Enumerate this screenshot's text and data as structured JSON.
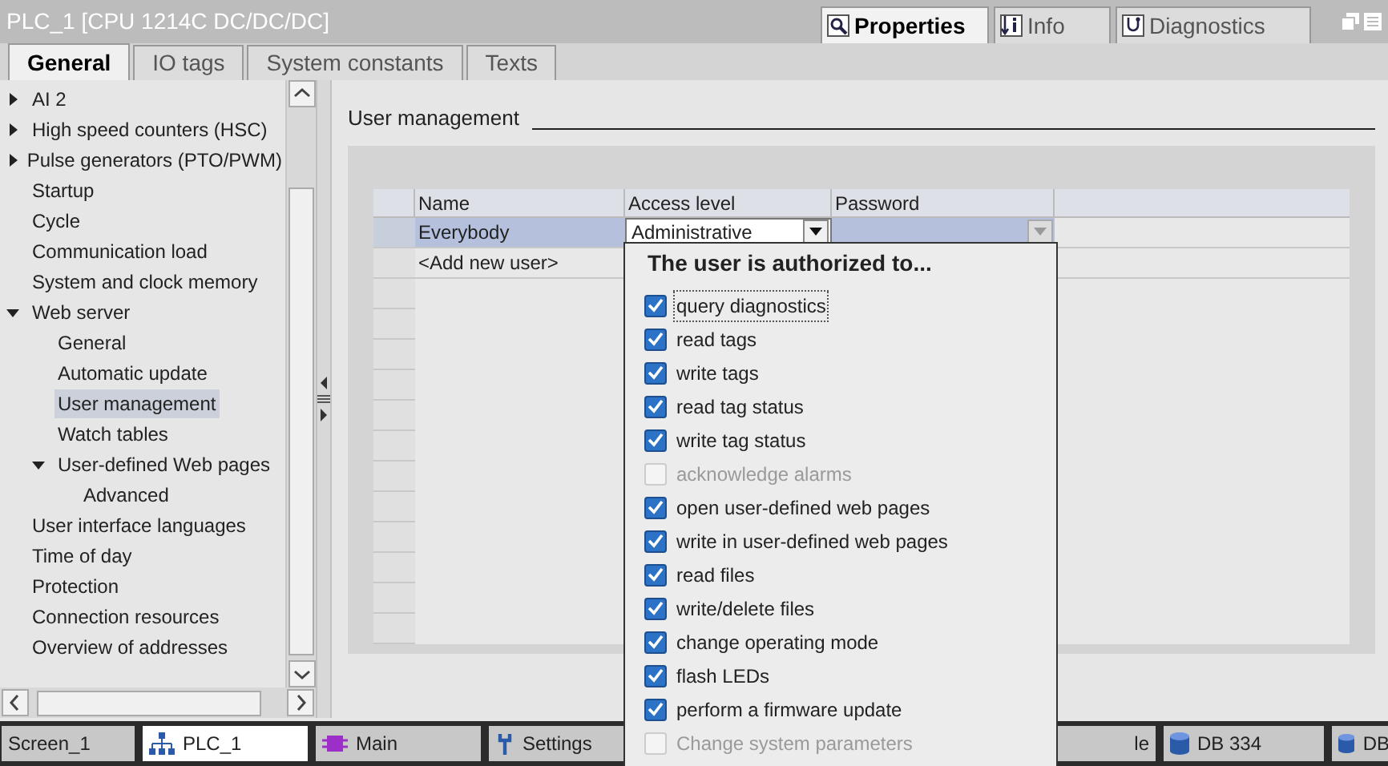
{
  "window": {
    "title": "PLC_1 [CPU 1214C DC/DC/DC]"
  },
  "inspector_tabs": [
    {
      "label": "Properties",
      "selected": true
    },
    {
      "label": "Info",
      "selected": false
    },
    {
      "label": "Diagnostics",
      "selected": false
    }
  ],
  "tabs": [
    {
      "label": "General",
      "selected": true
    },
    {
      "label": "IO tags",
      "selected": false
    },
    {
      "label": "System constants",
      "selected": false
    },
    {
      "label": "Texts",
      "selected": false
    }
  ],
  "sidebar": {
    "items": [
      {
        "label": "AI 2",
        "expanded": false,
        "selected": false
      },
      {
        "label": "High speed counters (HSC)",
        "expanded": false,
        "selected": false
      },
      {
        "label": "Pulse generators (PTO/PWM)",
        "expanded": false,
        "selected": false
      },
      {
        "label": "Startup",
        "selected": false
      },
      {
        "label": "Cycle",
        "selected": false
      },
      {
        "label": "Communication load",
        "selected": false
      },
      {
        "label": "System and clock memory",
        "selected": false
      },
      {
        "label": "Web server",
        "expanded": true,
        "selected": false,
        "children": [
          {
            "label": "General",
            "selected": false
          },
          {
            "label": "Automatic update",
            "selected": false
          },
          {
            "label": "User management",
            "selected": true
          },
          {
            "label": "Watch tables",
            "selected": false
          },
          {
            "label": "User-defined Web pages",
            "expanded": true,
            "selected": false,
            "children": [
              {
                "label": "Advanced",
                "selected": false
              }
            ]
          }
        ]
      },
      {
        "label": "User interface languages",
        "selected": false
      },
      {
        "label": "Time of day",
        "selected": false
      },
      {
        "label": "Protection",
        "selected": false
      },
      {
        "label": "Connection resources",
        "selected": false
      },
      {
        "label": "Overview of addresses",
        "selected": false
      }
    ]
  },
  "section": {
    "title": "User management"
  },
  "table": {
    "columns": [
      "Name",
      "Access level",
      "Password"
    ],
    "rows": [
      {
        "name": "Everybody",
        "access_level": "Administrative",
        "selected": true
      },
      {
        "name": "<Add new user>",
        "selected": false
      }
    ]
  },
  "popup": {
    "title": "The user is authorized to...",
    "items": [
      {
        "label": "query diagnostics",
        "checked": true,
        "disabled": false,
        "focused": true
      },
      {
        "label": "read tags",
        "checked": true,
        "disabled": false,
        "focused": false
      },
      {
        "label": "write tags",
        "checked": true,
        "disabled": false,
        "focused": false
      },
      {
        "label": "read tag status",
        "checked": true,
        "disabled": false,
        "focused": false
      },
      {
        "label": "write tag status",
        "checked": true,
        "disabled": false,
        "focused": false
      },
      {
        "label": "acknowledge alarms",
        "checked": false,
        "disabled": true,
        "focused": false
      },
      {
        "label": "open user-defined web pages",
        "checked": true,
        "disabled": false,
        "focused": false
      },
      {
        "label": "write in user-defined web pages",
        "checked": true,
        "disabled": false,
        "focused": false
      },
      {
        "label": "read files",
        "checked": true,
        "disabled": false,
        "focused": false
      },
      {
        "label": "write/delete files",
        "checked": true,
        "disabled": false,
        "focused": false
      },
      {
        "label": "change operating mode",
        "checked": true,
        "disabled": false,
        "focused": false
      },
      {
        "label": "flash LEDs",
        "checked": true,
        "disabled": false,
        "focused": false
      },
      {
        "label": "perform a firmware update",
        "checked": true,
        "disabled": false,
        "focused": false
      },
      {
        "label": "Change system parameters",
        "checked": false,
        "disabled": true,
        "focused": false
      }
    ]
  },
  "taskbar": [
    {
      "label": "Screen_1",
      "selected": false
    },
    {
      "label": "PLC_1",
      "selected": true
    },
    {
      "label": "Main",
      "selected": false
    },
    {
      "label": "Settings",
      "selected": false
    },
    {
      "label": "le",
      "selected": false
    },
    {
      "label": "DB 334",
      "selected": false
    },
    {
      "label": "DB",
      "selected": false
    }
  ]
}
